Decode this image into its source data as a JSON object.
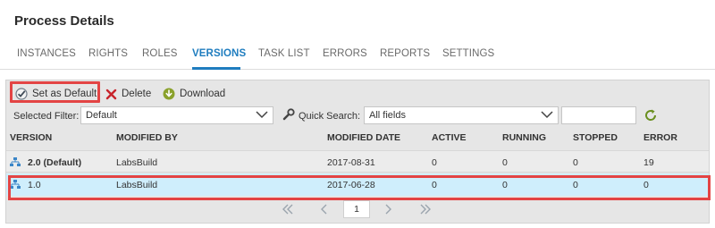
{
  "page": {
    "title": "Process Details"
  },
  "tabs": [
    {
      "label": "INSTANCES"
    },
    {
      "label": "RIGHTS"
    },
    {
      "label": "ROLES"
    },
    {
      "label": "VERSIONS",
      "active": true
    },
    {
      "label": "TASK LIST"
    },
    {
      "label": "ERRORS"
    },
    {
      "label": "REPORTS"
    },
    {
      "label": "SETTINGS"
    }
  ],
  "toolbar": {
    "set_default_label": "Set as Default",
    "delete_label": "Delete",
    "download_label": "Download"
  },
  "filters": {
    "selected_filter_label": "Selected Filter:",
    "selected_filter_value": "Default",
    "quick_search_label": "Quick Search:",
    "quick_search_field": "All fields",
    "quick_search_text": ""
  },
  "table": {
    "columns": [
      "VERSION",
      "MODIFIED BY",
      "MODIFIED DATE",
      "ACTIVE",
      "RUNNING",
      "STOPPED",
      "ERROR"
    ],
    "rows": [
      {
        "version": "2.0 (Default)",
        "modified_by": "LabsBuild",
        "modified_date": "2017-08-31",
        "active": "0",
        "running": "0",
        "stopped": "0",
        "error": "19"
      },
      {
        "version": "1.0",
        "modified_by": "LabsBuild",
        "modified_date": "2017-06-28",
        "active": "0",
        "running": "0",
        "stopped": "0",
        "error": "0"
      }
    ]
  },
  "pager": {
    "current_page": "1"
  },
  "colors": {
    "accent": "#1f7dbf",
    "highlight": "#e34444",
    "selected_row": "#cfeefc",
    "panel": "#e6e6e6"
  },
  "icons": [
    "check-circle-icon",
    "delete-x-icon",
    "download-icon",
    "wrench-search-icon",
    "refresh-icon",
    "version-tree-icon",
    "first-page-icon",
    "prev-page-icon",
    "next-page-icon",
    "last-page-icon"
  ]
}
